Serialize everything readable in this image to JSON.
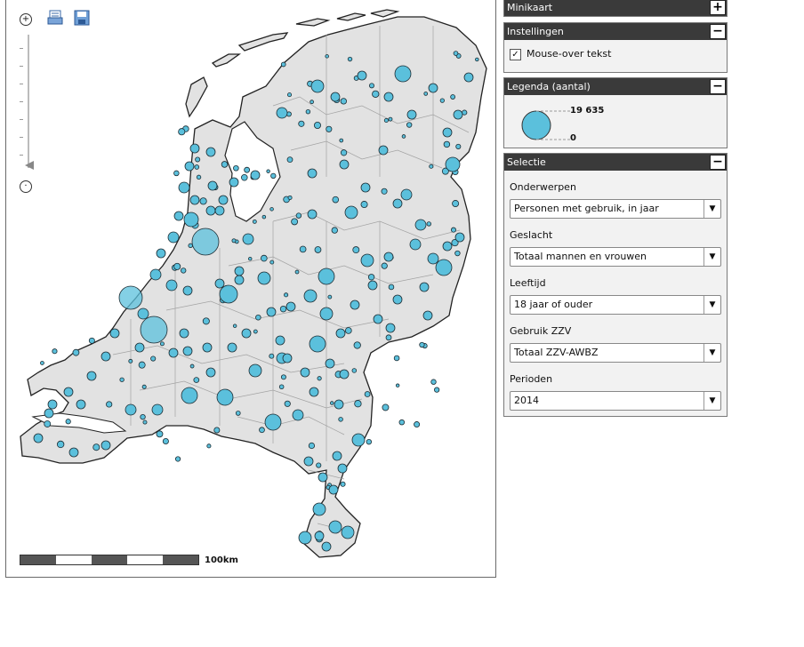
{
  "map": {
    "scale_label": "100km",
    "zoom_in_icon": "plus-circle-icon",
    "zoom_out_icon": "minus-circle-icon",
    "print_icon": "print-icon",
    "save_icon": "save-icon",
    "bubble_color": "#5bc0dc"
  },
  "panels": {
    "minimap": {
      "title": "Minikaart",
      "toggle": "+"
    },
    "settings": {
      "title": "Instellingen",
      "toggle": "−",
      "checkbox_label": "Mouse-over tekst",
      "checked": "✓"
    },
    "legend": {
      "title": "Legenda (aantal)",
      "toggle": "−",
      "max_value": "19 635",
      "min_value": "0"
    },
    "selection": {
      "title": "Selectie",
      "toggle": "−",
      "fields": [
        {
          "label": "Onderwerpen",
          "value": "Personen met gebruik, in jaar"
        },
        {
          "label": "Geslacht",
          "value": "Totaal mannen en vrouwen"
        },
        {
          "label": "Leeftijd",
          "value": "18 jaar of ouder"
        },
        {
          "label": "Gebruik ZZV",
          "value": "Totaal ZZV-AWBZ"
        },
        {
          "label": "Perioden",
          "value": "2014"
        }
      ]
    }
  }
}
